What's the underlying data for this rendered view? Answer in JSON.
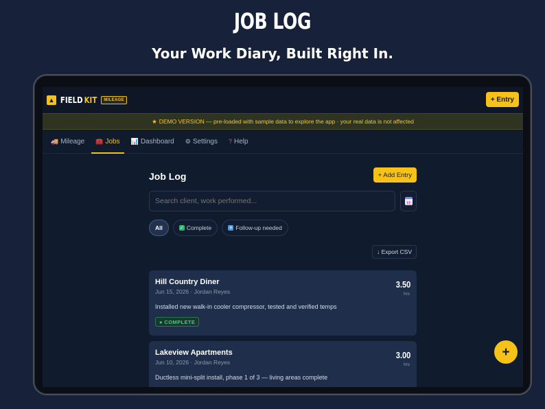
{
  "promo": {
    "title": "JOB LOG",
    "subtitle": "Your Work Diary, Built Right In."
  },
  "app": {
    "logo_field": "FIELD",
    "logo_kit": "KIT",
    "logo_badge": "MILEAGE",
    "entry_button": "+ Entry"
  },
  "banner": {
    "icon": "star-icon",
    "text": "DEMO VERSION — pre-loaded with sample data to explore the app · your real data is not affected"
  },
  "tabs": [
    {
      "icon": "truck-icon",
      "label": "Mileage",
      "active": false
    },
    {
      "icon": "toolbox-icon",
      "label": "Jobs",
      "active": true
    },
    {
      "icon": "chart-icon",
      "label": "Dashboard",
      "active": false
    },
    {
      "icon": "gear-icon",
      "label": "Settings",
      "active": false
    },
    {
      "icon": "question-icon",
      "label": "Help",
      "active": false
    }
  ],
  "main": {
    "title": "Job Log",
    "add_entry": "+ Add Entry",
    "search_placeholder": "Search client, work performed...",
    "filters": [
      {
        "label": "All",
        "active": true
      },
      {
        "label": "Complete",
        "icon": "check-icon",
        "active": false
      },
      {
        "label": "Follow-up needed",
        "icon": "clipboard-icon",
        "active": false
      }
    ],
    "export": "↓ Export CSV"
  },
  "jobs": [
    {
      "client": "Hill Country Diner",
      "meta": "Jun 15, 2026 · Jordan Reyes",
      "description": "Installed new walk-in cooler compressor, tested and verified temps",
      "hours": "3.50",
      "hours_unit": "hrs",
      "status": "● COMPLETE"
    },
    {
      "client": "Lakeview Apartments",
      "meta": "Jun 10, 2026 · Jordan Reyes",
      "description": "Ductless mini-split install, phase 1 of 3 — living areas complete",
      "hours": "3.00",
      "hours_unit": "hrs"
    }
  ],
  "fab": "+",
  "colors": {
    "accent": "#f6c21a",
    "background": "#17223a",
    "screen": "#111b2e",
    "card": "#1f2e4a",
    "complete": "#35d07f"
  }
}
